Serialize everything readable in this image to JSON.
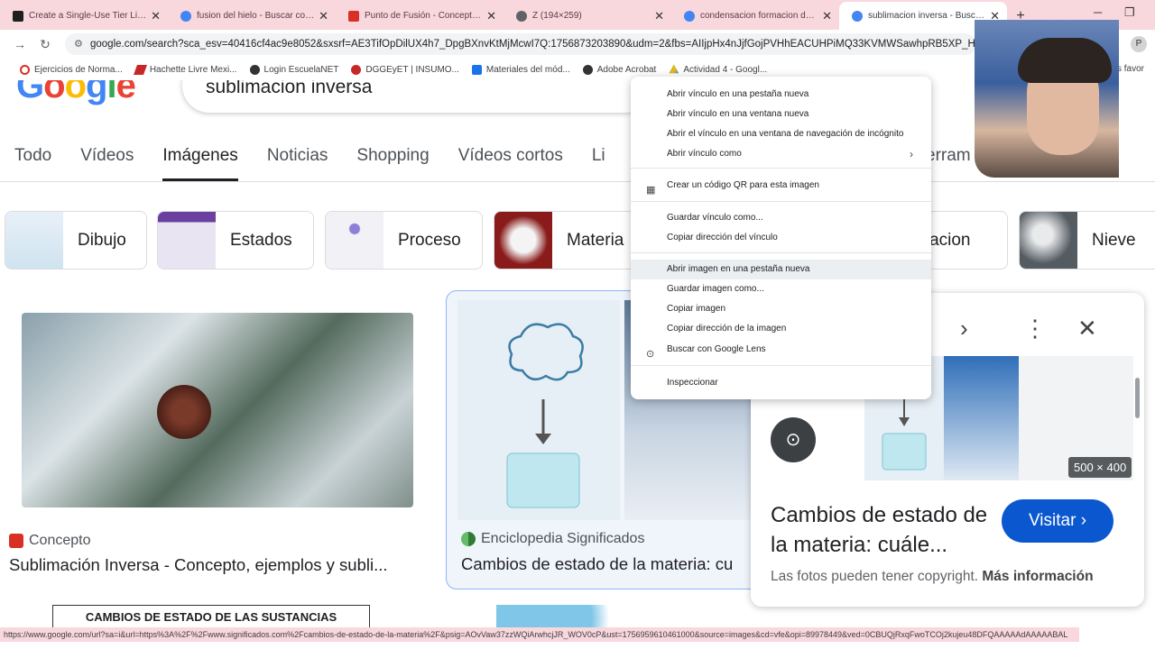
{
  "tabs": [
    {
      "title": "Create a Single-Use Tier List (Pr",
      "color": "#1f1f1f",
      "active": false
    },
    {
      "title": "fusion del hielo - Buscar con Go",
      "color": "#4285f4",
      "active": false
    },
    {
      "title": "Punto de Fusión - Concepto, ej",
      "color": "#d93025",
      "active": false
    },
    {
      "title": "Z (194×259)",
      "color": "#5f6368",
      "active": false
    },
    {
      "title": "condensacion formacion de nu",
      "color": "#4285f4",
      "active": false
    },
    {
      "title": "sublimacion inversa - Buscar co",
      "color": "#4285f4",
      "active": true
    }
  ],
  "new_tab_label": "+",
  "window_controls": {
    "minimize": "─",
    "restore": "❐"
  },
  "url": "google.com/search?sca_esv=40416cf4ac9e8052&sxsrf=AE3TifOpDilUX4h7_DpgBXnvKtMjMcwI7Q:1756873203890&udm=2&fbs=AIIjpHx4nJjfGojPVHhEACUHPiMQ33KVMWSawhpRB5XP_HUyXM2Vjh1M3",
  "profile_initial": "P",
  "bookmarks": [
    {
      "label": "Ejercicios de Norma...",
      "color": "#d93025"
    },
    {
      "label": "Hachette Livre Mexi...",
      "color": "#c62828"
    },
    {
      "label": "Login EscuelaNET",
      "color": "#333333"
    },
    {
      "label": "DGGEyET | INSUMO...",
      "color": "#c62828"
    },
    {
      "label": "Materiales del mód...",
      "color": "#1a73e8"
    },
    {
      "label": "Adobe Acrobat",
      "color": "#333333"
    },
    {
      "label": "Actividad 4 - Googl...",
      "color": "#fbbc04"
    }
  ],
  "bookmarks_right": "los favor",
  "search_query": "sublimacion inversa",
  "nav_tabs": [
    "Todo",
    "Vídeos",
    "Imágenes",
    "Noticias",
    "Shopping",
    "Vídeos cortos",
    "Li",
    "erram"
  ],
  "active_nav_tab": "Imágenes",
  "chips": [
    {
      "label": "Dibujo"
    },
    {
      "label": "Estados"
    },
    {
      "label": "Proceso"
    },
    {
      "label": "Materia"
    },
    {
      "label": "nsacion"
    },
    {
      "label": "Nieve"
    }
  ],
  "result1": {
    "source": "Concepto",
    "title": "Sublimación Inversa - Concepto, ejemplos y subli..."
  },
  "result2": {
    "source": "Enciclopedia Significados",
    "title": "Cambios de estado de la materia: cu"
  },
  "bottom_banner": "CAMBIOS DE ESTADO DE LAS SUSTANCIAS",
  "panel": {
    "size": "500 × 400",
    "title": "Cambios de estado de la materia: cuále...",
    "visit_label": "Visitar",
    "copyright_text": "Las fotos pueden tener copyright.",
    "more_info": "Más información"
  },
  "context_menu": [
    {
      "label": "Abrir vínculo en una pestaña nueva"
    },
    {
      "label": "Abrir vínculo en una ventana nueva"
    },
    {
      "label": "Abrir el vínculo en una ventana de navegación de incógnito"
    },
    {
      "label": "Abrir vínculo como"
    },
    {
      "label": "Crear un código QR para esta imagen"
    },
    {
      "label": "Guardar vínculo como..."
    },
    {
      "label": "Copiar dirección del vínculo"
    },
    {
      "label": "Abrir imagen en una pestaña nueva"
    },
    {
      "label": "Guardar imagen como..."
    },
    {
      "label": "Copiar imagen"
    },
    {
      "label": "Copiar dirección de la imagen"
    },
    {
      "label": "Buscar con Google Lens"
    },
    {
      "label": "Inspeccionar"
    }
  ],
  "status_url": "https://www.google.com/url?sa=i&url=https%3A%2F%2Fwww.significados.com%2Fcambios-de-estado-de-la-materia%2F&psig=AOvVaw37zzWQiArwhcjJR_WOV0cP&ust=1756959610461000&source=images&cd=vfe&opi=89978449&ved=0CBUQjRxqFwoTCOj2kujeu48DFQAAAAAdAAAAABAL"
}
